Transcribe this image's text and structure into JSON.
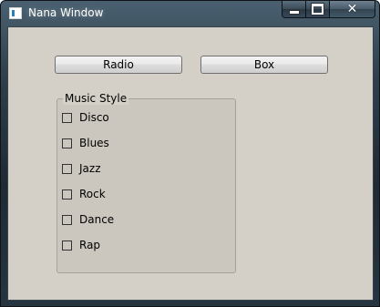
{
  "window": {
    "title": "Nana Window"
  },
  "buttons": {
    "radio_label": "Radio",
    "box_label": "Box"
  },
  "music_group": {
    "title": "Music Style",
    "options": [
      {
        "label": "Disco",
        "checked": false
      },
      {
        "label": "Blues",
        "checked": false
      },
      {
        "label": "Jazz",
        "checked": false
      },
      {
        "label": "Rock",
        "checked": false
      },
      {
        "label": "Dance",
        "checked": false
      },
      {
        "label": "Rap",
        "checked": false
      }
    ]
  },
  "icons": {
    "app": "app-window-icon",
    "minimize": "minimize-icon",
    "maximize": "maximize-icon",
    "close": "close-icon"
  },
  "colors": {
    "client_background": "#d4d0c8",
    "group_background": "#cbc7bf",
    "titlebar": "#2f3f4b"
  }
}
